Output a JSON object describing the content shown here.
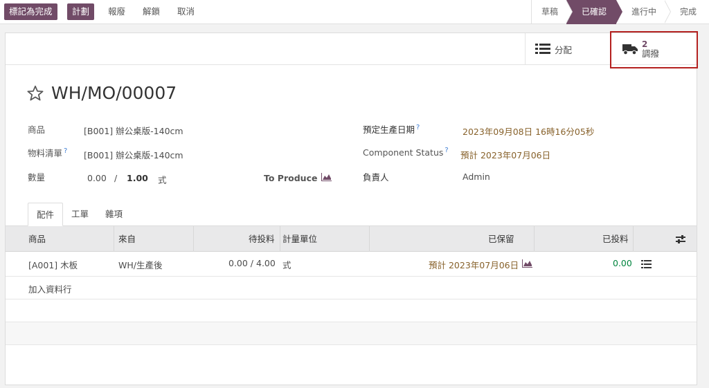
{
  "toolbar": {
    "mark_done": "標記為完成",
    "plan": "計劃",
    "scrap": "報廢",
    "unlock": "解鎖",
    "cancel": "取消"
  },
  "statusbar": [
    "草稿",
    "已確認",
    "進行中",
    "完成"
  ],
  "statusbar_active": "已確認",
  "smart_buttons": {
    "distribution_label": "分配",
    "transfers_count": "2",
    "transfers_label": "調撥"
  },
  "record": {
    "name": "WH/MO/00007",
    "product_label": "商品",
    "product_value": "[B001] 辦公桌版-140cm",
    "bom_label": "物料清單",
    "bom_value": "[B001] 辦公桌版-140cm",
    "qty_label": "數量",
    "qty_produced": "0.00",
    "qty_sep": "/",
    "qty_total": "1.00",
    "qty_uom": "式",
    "to_produce": "To Produce",
    "scheduled_label": "預定生產日期",
    "scheduled_value": "2023年09月08日 16時16分05秒",
    "component_status_label": "Component Status",
    "component_status_value": "預計 2023年07月06日",
    "responsible_label": "負責人",
    "responsible_value": "Admin",
    "help_mark": "?"
  },
  "tabs": [
    "配件",
    "工單",
    "雜項"
  ],
  "table": {
    "headers": {
      "product": "商品",
      "from": "來自",
      "to_consume": "待投料",
      "uom": "計量單位",
      "reserved": "已保留",
      "consumed": "已投料"
    },
    "rows": [
      {
        "product": "[A001] 木板",
        "from": "WH/生產後",
        "to_consume": "0.00 /  4.00",
        "uom": "式",
        "reserved": "預計 2023年07月06日",
        "consumed": "0.00"
      }
    ],
    "add_line": "加入資料行"
  },
  "colors": {
    "primary": "#714b67",
    "brown_text": "#87612a",
    "green_text": "#00843d",
    "highlight_box": "#b4201f"
  }
}
